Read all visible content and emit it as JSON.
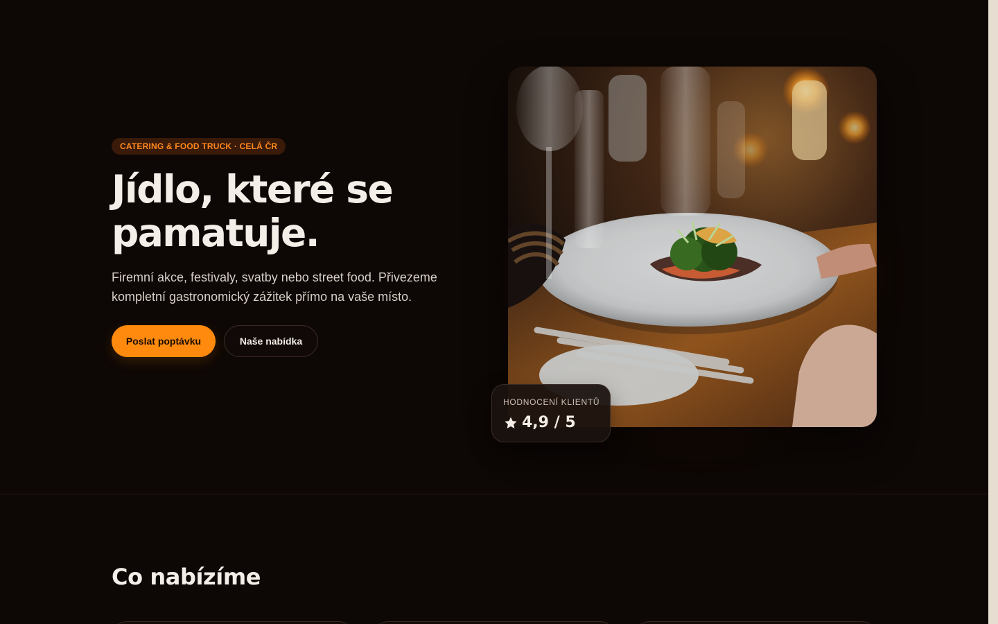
{
  "hero": {
    "badge": "CATERING & FOOD TRUCK · CELÁ ČR",
    "title_line1": "Jídlo, které se",
    "title_line2": "pamatuje.",
    "subtitle": "Firemní akce, festivaly, svatby nebo street food. Přivezeme kompletní gastronomický zážitek přímo na vaše místo.",
    "primary_button": "Poslat poptávku",
    "secondary_button": "Naše nabídka"
  },
  "rating": {
    "label": "HODNOCENÍ KLIENTŮ",
    "value": "4,9 / 5",
    "icon": "star-icon"
  },
  "offers": {
    "title": "Co nabízíme"
  },
  "colors": {
    "background": "#0d0705",
    "accent": "#ff8a0d",
    "text": "#f4eee8"
  }
}
